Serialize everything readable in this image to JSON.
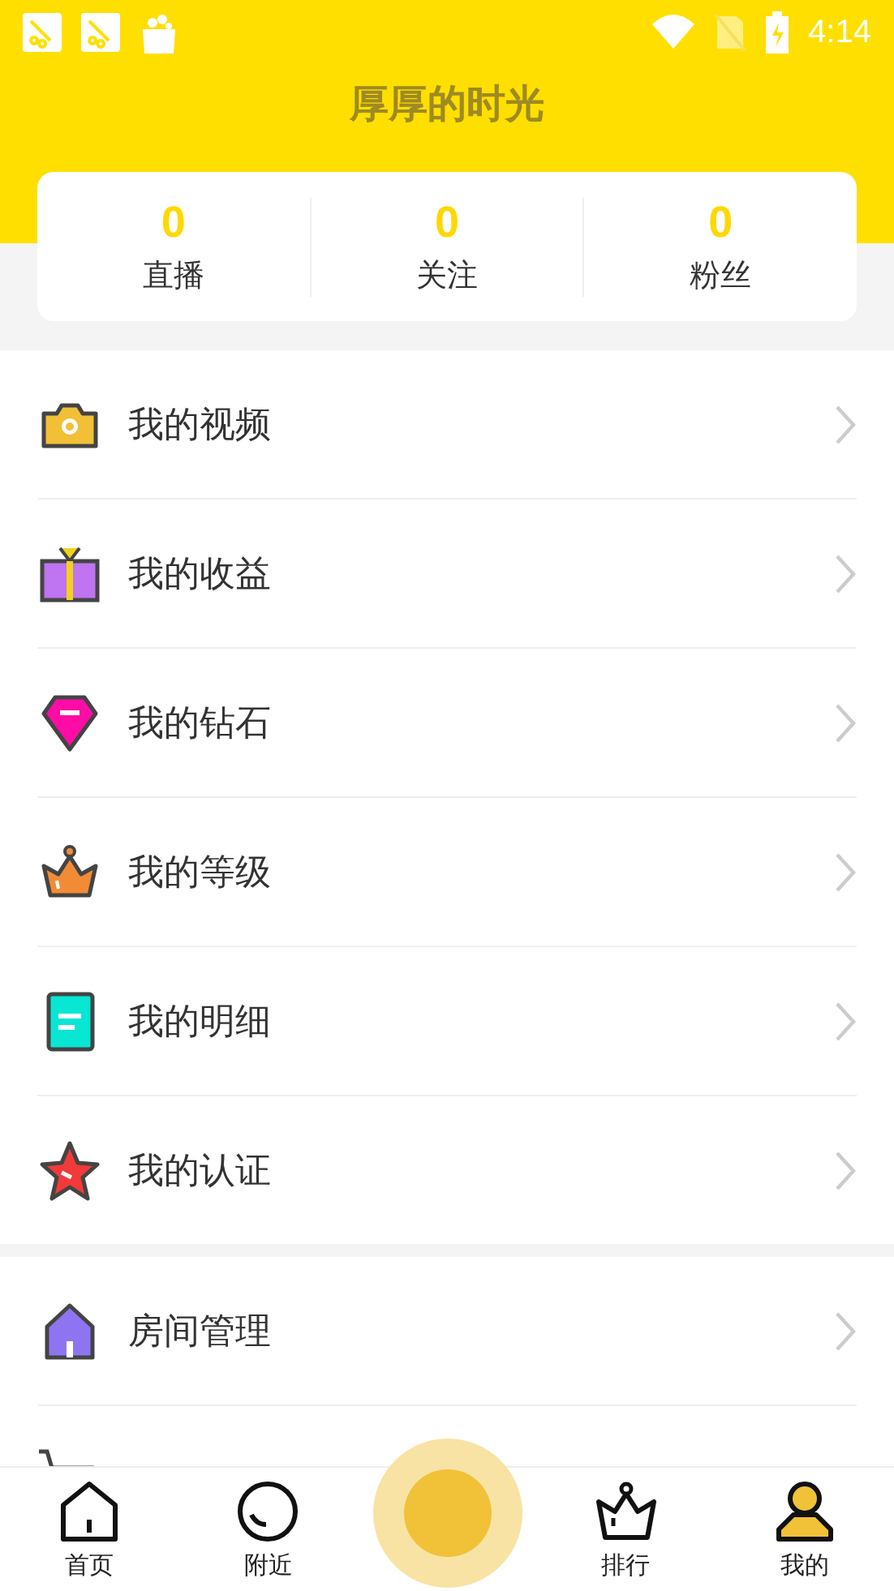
{
  "status_bar": {
    "time": "4:14"
  },
  "header": {
    "title": "厚厚的时光"
  },
  "stats": [
    {
      "value": "0",
      "label": "直播"
    },
    {
      "value": "0",
      "label": "关注"
    },
    {
      "value": "0",
      "label": "粉丝"
    }
  ],
  "menu_sections": [
    {
      "items": [
        {
          "kind": "row",
          "label": "我的视频"
        },
        {
          "kind": "row",
          "label": "我的收益"
        },
        {
          "kind": "row",
          "label": "我的钻石"
        },
        {
          "kind": "row",
          "label": "我的等级"
        },
        {
          "kind": "row",
          "label": "我的明细"
        },
        {
          "kind": "row",
          "label": "我的认证"
        }
      ]
    },
    {
      "items": [
        {
          "kind": "row",
          "label": "房间管理"
        },
        {
          "kind": "partial"
        }
      ]
    }
  ],
  "tab_bar": [
    {
      "kind": "tab",
      "label": "首页",
      "selected": false
    },
    {
      "kind": "tab",
      "label": "附近",
      "selected": false
    },
    {
      "kind": "center"
    },
    {
      "kind": "tab",
      "label": "排行",
      "selected": false
    },
    {
      "kind": "tab",
      "label": "我的",
      "selected": true
    }
  ]
}
